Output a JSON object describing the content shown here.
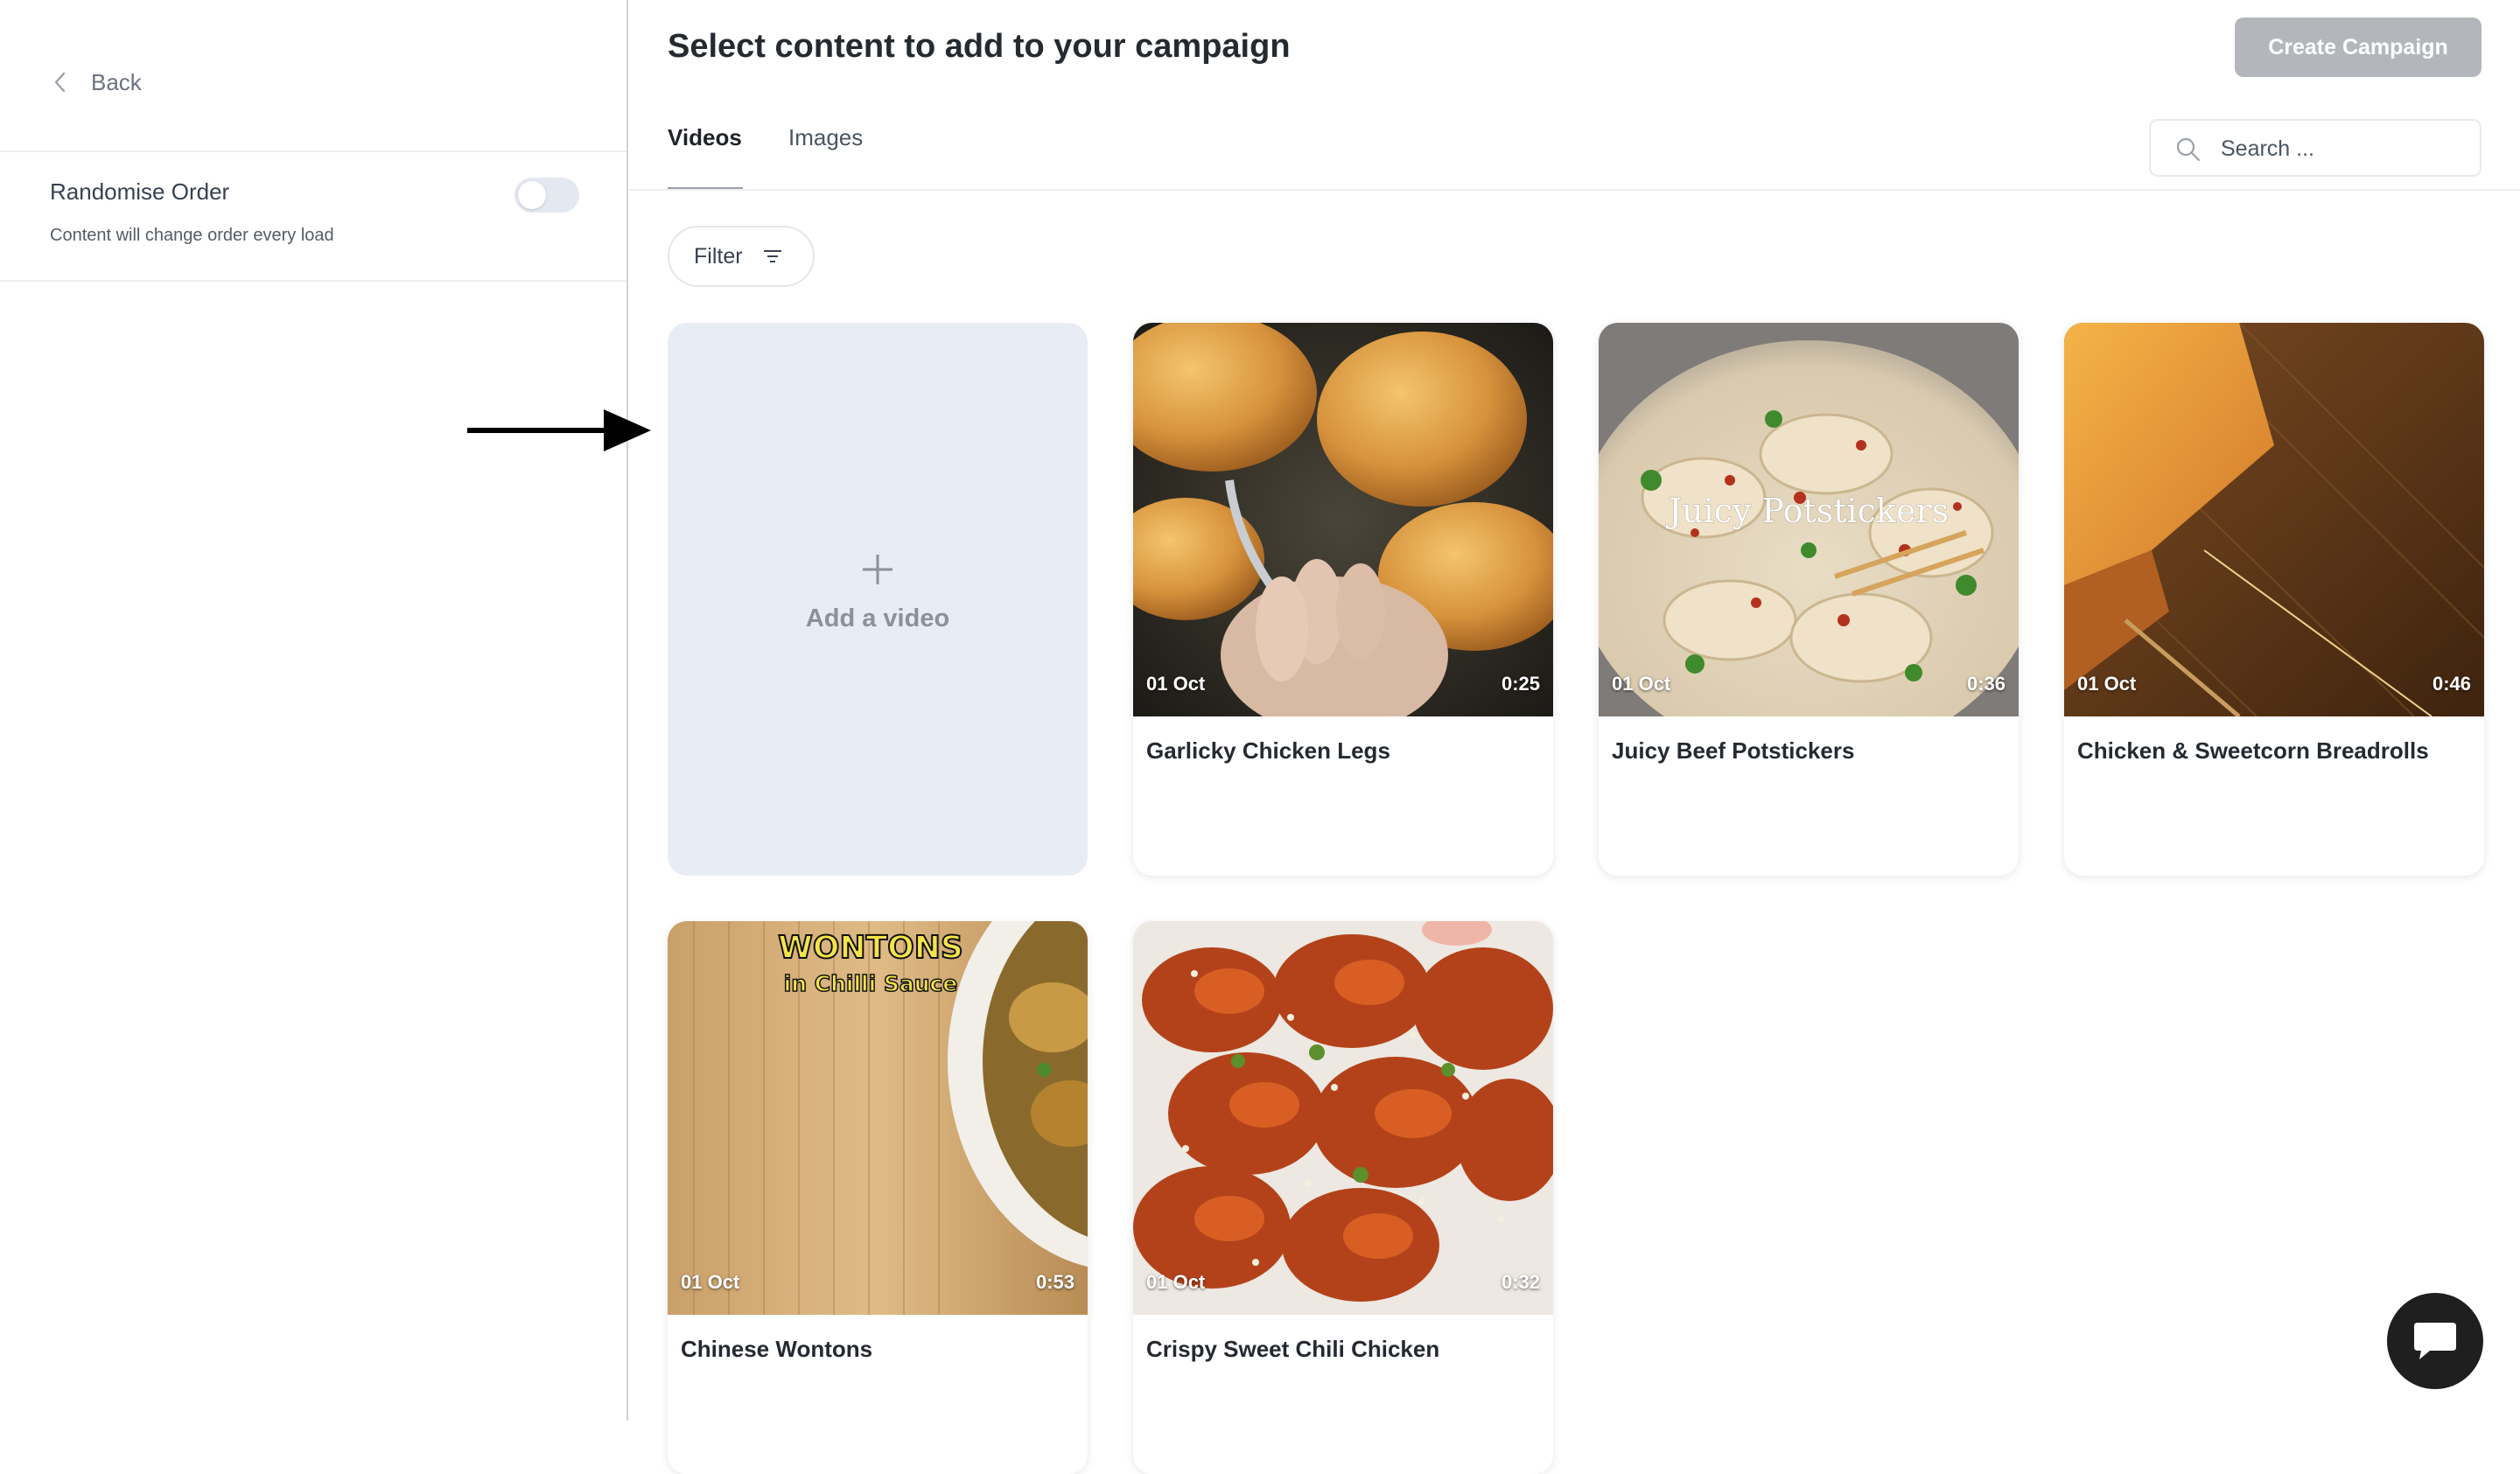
{
  "sidebar": {
    "back_label": "Back",
    "randomise": {
      "title": "Randomise Order",
      "description": "Content will change order every load",
      "enabled": false
    }
  },
  "header": {
    "title": "Select content to add to your campaign",
    "create_button": "Create Campaign"
  },
  "tabs": [
    {
      "label": "Videos",
      "active": true
    },
    {
      "label": "Images",
      "active": false
    }
  ],
  "search": {
    "placeholder": "Search ..."
  },
  "filter": {
    "label": "Filter"
  },
  "add_card": {
    "label": "Add a video"
  },
  "videos": [
    {
      "title": "Garlicky Chicken Legs",
      "date": "01 Oct",
      "duration": "0:25"
    },
    {
      "title": "Juicy Beef Potstickers",
      "date": "01 Oct",
      "duration": "0:36",
      "overlay_text": "Juicy Potstickers"
    },
    {
      "title": "Chicken & Sweetcorn Breadrolls",
      "date": "01 Oct",
      "duration": "0:46"
    },
    {
      "title": "Chinese Wontons",
      "date": "01 Oct",
      "duration": "0:53",
      "overlay_text": [
        "WONTONS",
        "in Chilli Sauce"
      ]
    },
    {
      "title": "Crispy Sweet Chili Chicken",
      "date": "01 Oct",
      "duration": "0:32"
    }
  ],
  "colors": {
    "create_button_bg": "#b3b6ba",
    "add_card_bg": "#e8edf5",
    "toggle_off": "#e4e8f0",
    "chat_bg": "#1f1f1f"
  }
}
